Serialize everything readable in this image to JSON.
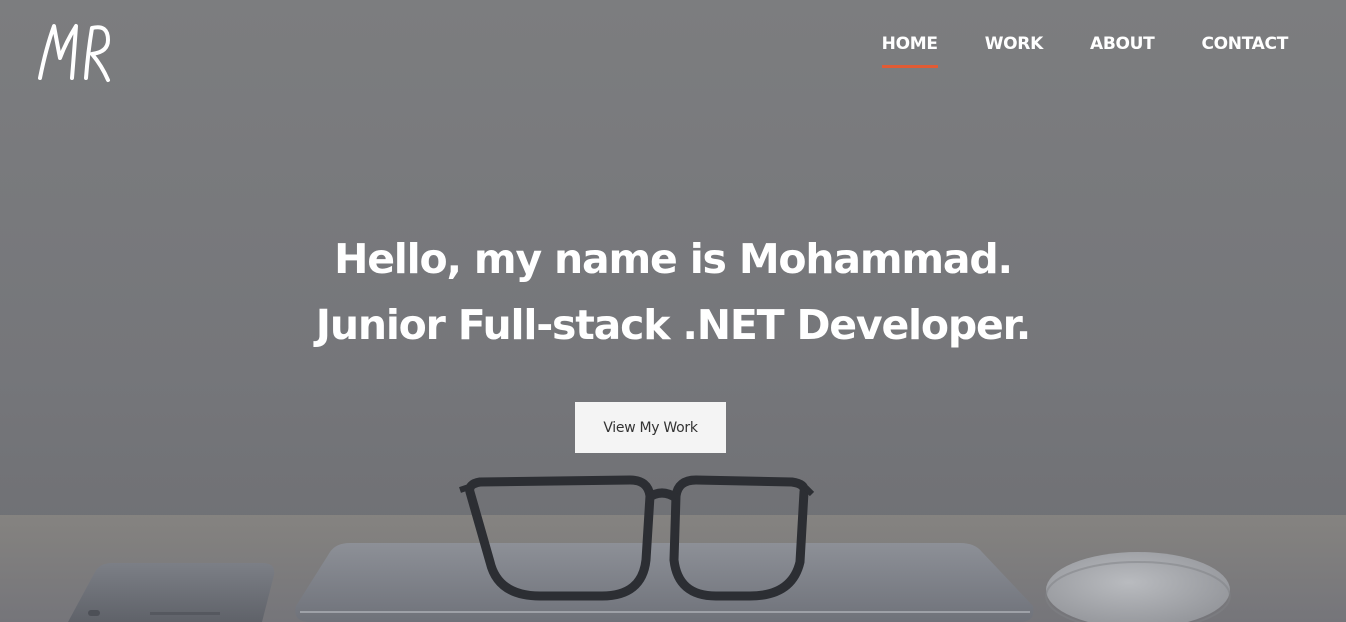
{
  "logo": {
    "text": "MR"
  },
  "nav": {
    "items": [
      {
        "label": "HOME",
        "active": true
      },
      {
        "label": "WORK",
        "active": false
      },
      {
        "label": "ABOUT",
        "active": false
      },
      {
        "label": "CONTACT",
        "active": false
      }
    ],
    "active_color": "#e15b34"
  },
  "hero": {
    "line1": "Hello, my name is Mohammad.",
    "line2": "Junior Full-stack .NET Developer.",
    "cta_label": "View My Work"
  },
  "icons": {
    "logo": "mr-logo-icon",
    "background": "desk-photo-icon"
  }
}
